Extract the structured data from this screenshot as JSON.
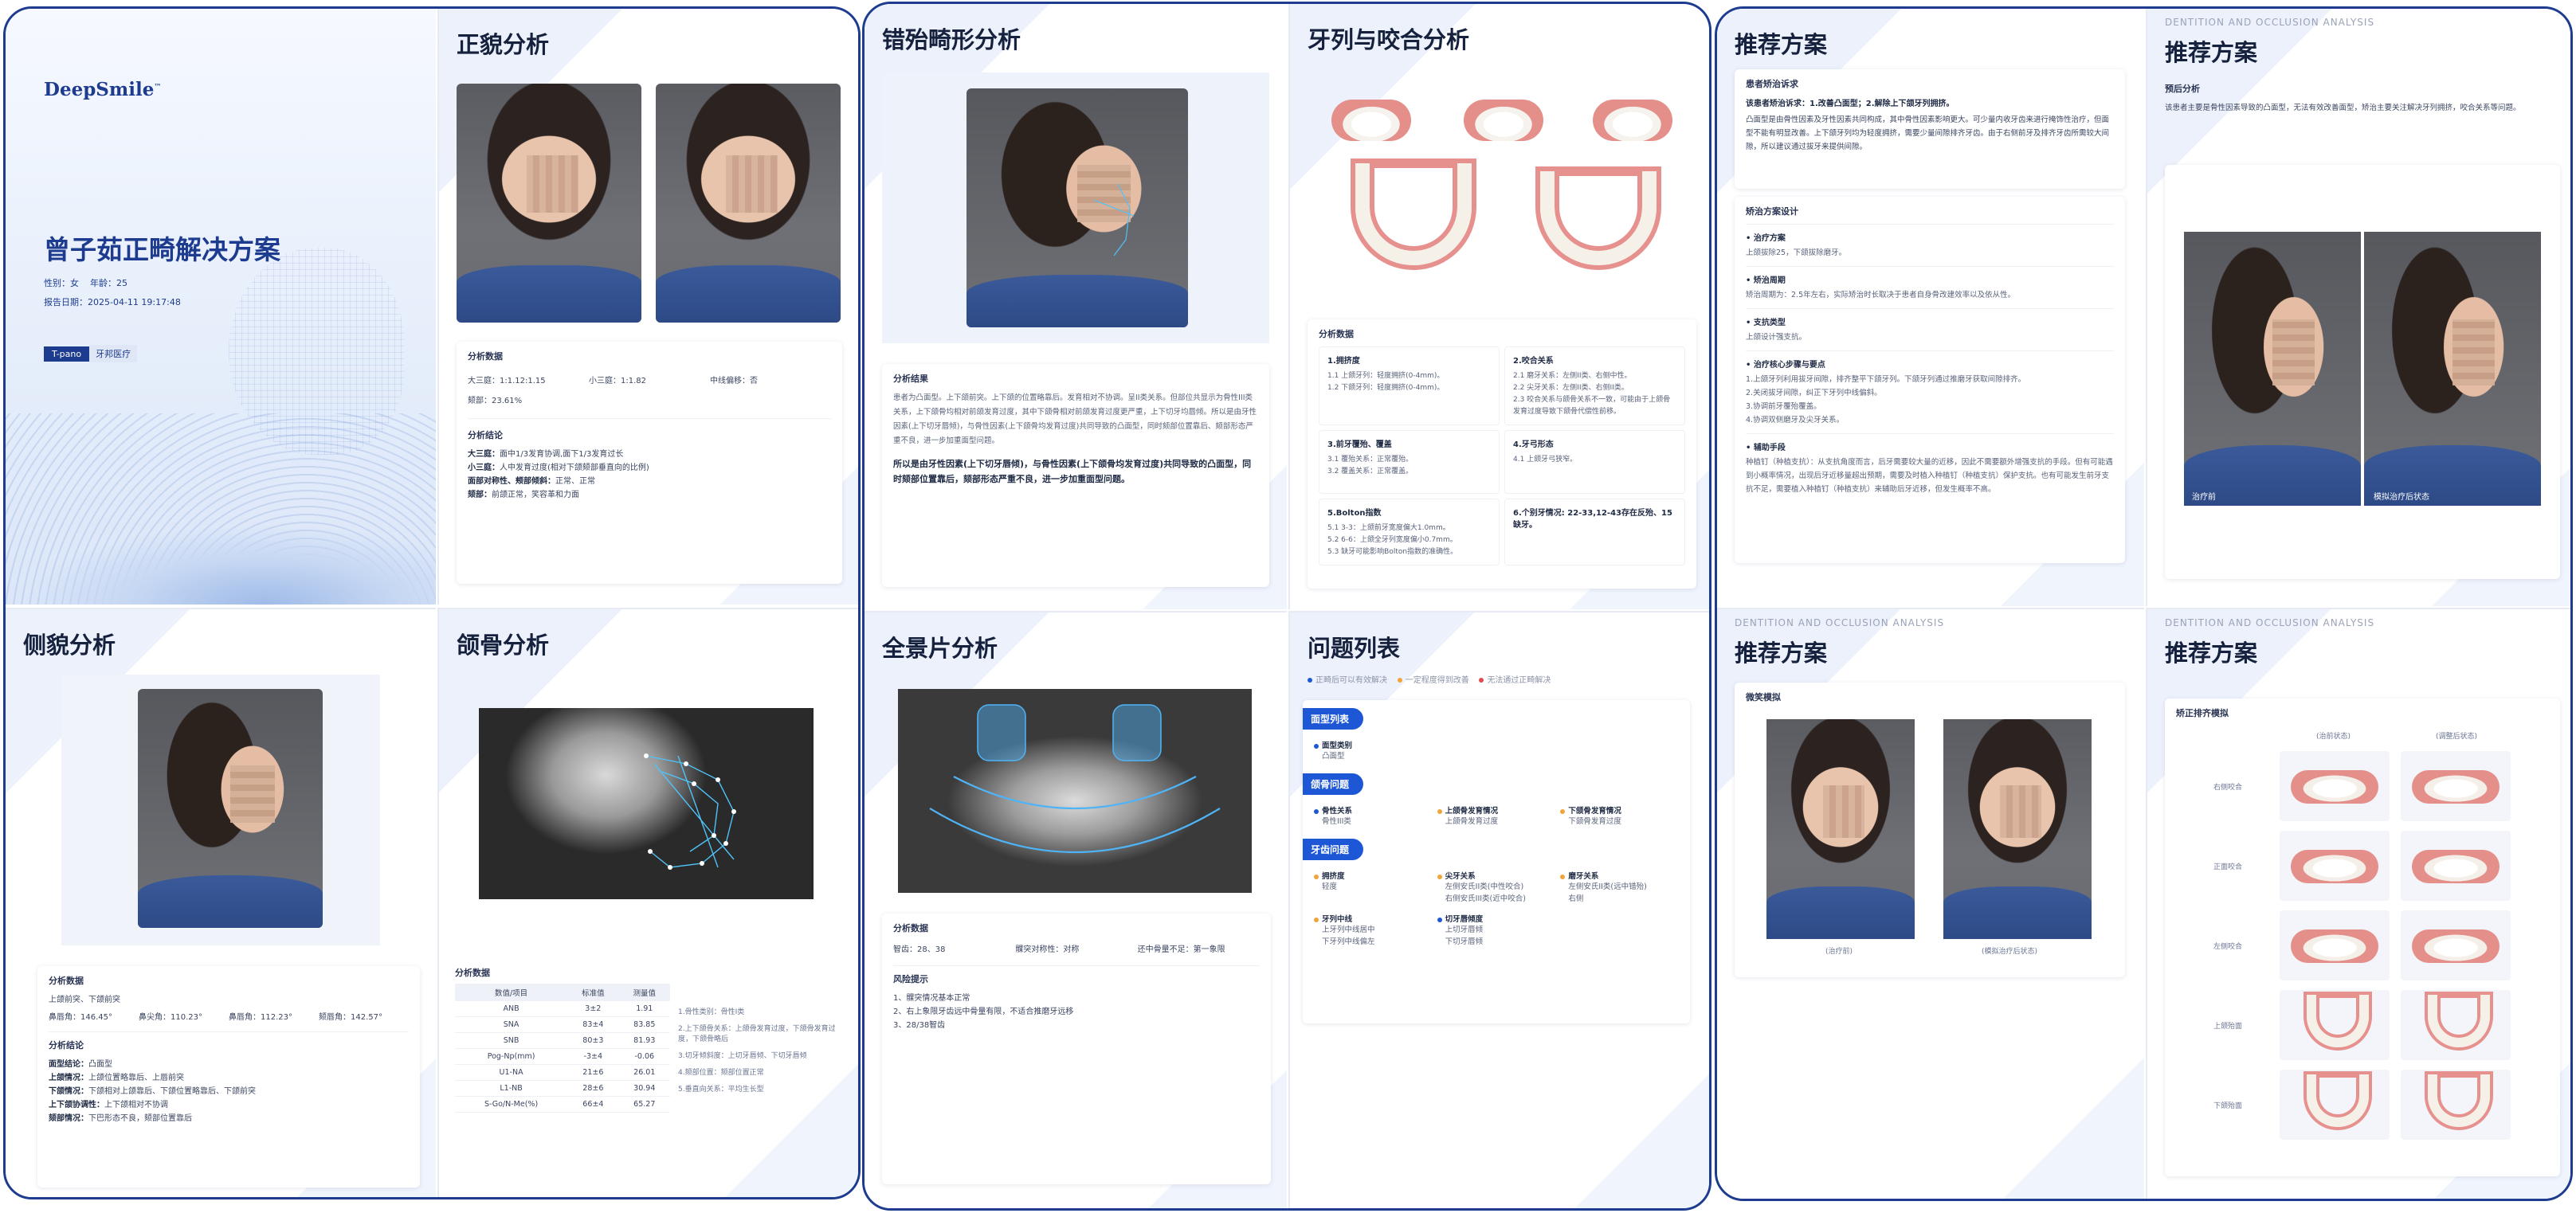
{
  "colors": {
    "brand": "#1d3b8f",
    "accent": "#1d57d6",
    "cover_bg": "#e9f0fb"
  },
  "cover": {
    "logo": "DeepSmile",
    "logo_tm": "™",
    "title": "曾子茹正畸解决方案",
    "gender": "性别：女",
    "age": "年龄：25",
    "report_date": "报告日期：2025-04-11 19:17:48",
    "brand_tag": "T-pano",
    "brand_tag2": "牙邦医疗"
  },
  "frontal": {
    "title": "正貌分析",
    "data_title": "分析数据",
    "items": [
      "大三庭：1:1.12:1.15",
      "小三庭：1:1.82",
      "中线偏移：否",
      "颏部：23.61%"
    ],
    "conclusion_title": "分析结论",
    "conclusions": [
      {
        "k": "大三庭：",
        "v": "面中1/3发育协调,面下1/3发育过长"
      },
      {
        "k": "小三庭：",
        "v": "人中发育过度(相对下颌颏部垂直向的比例)"
      },
      {
        "k": "面部对称性、颊部倾斜：",
        "v": "正常、正常"
      },
      {
        "k": "颏部：",
        "v": "前颌正常，笑容革和力面"
      }
    ]
  },
  "lateral": {
    "title": "侧貌分析",
    "data_title": "分析数据",
    "line1": "上颌前突、下颌前突",
    "angles": [
      "鼻唇角：146.45°",
      "鼻尖角：110.23°",
      "鼻唇角：112.23°",
      "颏唇角：142.57°"
    ],
    "conclusion_title": "分析结论",
    "conclusions": [
      {
        "k": "面型结论：",
        "v": "凸面型"
      },
      {
        "k": "上颌情况：",
        "v": "上颌位置略靠后、上唇前突"
      },
      {
        "k": "下颌情况：",
        "v": "下颌相对上颌靠后、下颌位置略靠后、下颌前突"
      },
      {
        "k": "上下颌协调性：",
        "v": "上下颌相对不协调"
      },
      {
        "k": "颏部情况：",
        "v": "下巴形态不良，颏部位置靠后"
      }
    ]
  },
  "ceph": {
    "title": "颌骨分析",
    "data_title": "分析数据",
    "headers": [
      "数值/项目",
      "标准值",
      "测量值"
    ],
    "rows": [
      [
        "ANB",
        "3±2",
        "1.91"
      ],
      [
        "SNA",
        "83±4",
        "83.85"
      ],
      [
        "SNB",
        "80±3",
        "81.93"
      ],
      [
        "Pog-Np(mm)",
        "-3±4",
        "-0.06"
      ],
      [
        "U1-NA",
        "21±6",
        "26.01"
      ],
      [
        "L1-NB",
        "28±6",
        "30.94"
      ],
      [
        "S-Go/N-Me(%)",
        "66±4",
        "65.27"
      ]
    ],
    "notes": [
      "1.骨性类别：骨性I类",
      "2.上下颌骨关系：上颌骨发育过度，下颌骨发育过度，下颌骨略后",
      "3.切牙倾斜度：上切牙唇倾、下切牙唇倾",
      "4.颏部位置：颏部位置正常",
      "5.垂直向关系：平均生长型"
    ]
  },
  "malocclusion": {
    "title": "错殆畸形分析",
    "result_title": "分析结果",
    "paragraph": "患者为凸面型。上下颌前突。上下颌的位置略靠后。发育相对不协调。呈II类关系。但部位共显示为骨性III类关系，上下颌骨均相对前颌发育过度，其中下颌骨相对前颌发育过度更严重，上下切牙均唇倾。所以是由牙性因素(上下切牙唇倾)，与骨性因素(上下颌骨均发育过度)共同导致的凸面型，同时颏部位置靠后、颏部形态严重不良，进一步加重面型问题。",
    "bold": "所以是由牙性因素(上下切牙唇倾)，与骨性因素(上下颌骨均发育过度)共同导致的凸面型，同时颏部位置靠后，颏部形态严重不良，进一步加重面型问题。"
  },
  "dentition": {
    "title": "牙列与咬合分析",
    "data_title": "分析数据",
    "boxes": [
      {
        "h": "1.拥挤度",
        "lines": [
          "1.1  上颌牙列：轻度拥挤(0-4mm)。",
          "1.2  下颌牙列：轻度拥挤(0-4mm)。"
        ]
      },
      {
        "h": "2.咬合关系",
        "lines": [
          "2.1  磨牙关系：左侧II类、右侧中性。",
          "2.2  尖牙关系：左侧II类、右侧II类。",
          "2.3  咬合关系与颌骨关系不一致，可能由于上颌骨发育过度导致下颌骨代偿性前移。"
        ]
      },
      {
        "h": "3.前牙覆殆、覆盖",
        "lines": [
          "3.1  覆殆关系：正常覆殆。",
          "3.2  覆盖关系：正常覆盖。"
        ]
      },
      {
        "h": "4.牙弓形态",
        "lines": [
          "4.1  上颌牙弓狭窄。"
        ]
      },
      {
        "h": "5.Bolton指数",
        "lines": [
          "5.1  3-3：上颌前牙宽度偏大1.0mm。",
          "5.2  6-6：上颌全牙列宽度偏小0.7mm。",
          "5.3  缺牙可能影响Bolton指数的准确性。"
        ]
      },
      {
        "h": "6.个别牙情况: 22-33,12-43存在反殆、15缺牙。",
        "lines": []
      }
    ]
  },
  "pano": {
    "title": "全景片分析",
    "data_title": "分析数据",
    "items": [
      "智齿：28、38",
      "髁突对称性：对称",
      "还中骨量不足：第一象限"
    ],
    "risk_title": "风险提示",
    "risks": [
      "1、髁突情况基本正常",
      "2、右上象限牙齿远中骨量有限，不适合推磨牙远移",
      "3、28/38智齿"
    ]
  },
  "problems": {
    "title": "问题列表",
    "legend": [
      "正畸后可以有效解决",
      "一定程度得到改善",
      "无法通过正畸解决"
    ],
    "sections": [
      {
        "name": "面型列表",
        "items": [
          {
            "h": "面型类别",
            "v": "凸面型"
          }
        ]
      },
      {
        "name": "颌骨问题",
        "items": [
          {
            "h": "骨性关系",
            "v": "骨性III类"
          },
          {
            "h": "上颌骨发育情况",
            "v": "上颌骨发育过度"
          },
          {
            "h": "下颌骨发育情况",
            "v": "下颌骨发育过度"
          }
        ]
      },
      {
        "name": "牙齿问题",
        "items": [
          {
            "h": "拥挤度",
            "v": "轻度"
          },
          {
            "h": "尖牙关系",
            "v": "左侧安氏II类(中性咬合)\n右侧安氏III类(近中咬合)"
          },
          {
            "h": "磨牙关系",
            "v": "左侧安氏II类(远中错殆)\n右侧"
          },
          {
            "h": "牙列中线",
            "v": "上牙列中线居中\n下牙列中线偏左"
          },
          {
            "h": "切牙唇倾度",
            "v": "上切牙唇倾\n下切牙唇倾"
          }
        ]
      }
    ]
  },
  "plan1": {
    "title": "推荐方案",
    "demand_title": "患者矫治诉求",
    "demand_bold": "该患者矫治诉求：1.改善凸面型；2.解除上下颌牙列拥挤。",
    "demand_text": "凸面型是由骨性因素及牙性因素共同构成，其中骨性因素影响更大。可少量内收牙齿来进行掩饰性治疗，但面型不能有明显改善。上下颌牙列均为轻度拥挤，需要少量间隙排齐牙齿。由于右侧前牙及排齐牙齿所需较大间隙，所以建议通过拔牙来提供间隙。",
    "design_title": "矫治方案设计",
    "sections": [
      {
        "h": "治疗方案",
        "t": "上颌拔除25，下颌拔除磨牙。"
      },
      {
        "h": "矫治周期",
        "t": "矫治周期为：2.5年左右，实际矫治时长取决于患者自身骨改建效率以及依从性。"
      },
      {
        "h": "支抗类型",
        "t": "上颌设计强支抗。"
      },
      {
        "h": "治疗核心步骤与要点",
        "t": "1.上颌牙列利用拔牙间隙，排齐整平下颌牙列。下颌牙列通过推磨牙获取间隙排齐。\n2.关闭拔牙间隙，纠正下牙列中线偏斜。\n3.协调前牙覆殆覆盖。\n4.协调双侧磨牙及尖牙关系。"
      },
      {
        "h": "辅助手段",
        "t": "种植钉（种植支抗）：从支抗角度而言，后牙需要较大量的近移，因此不需要额外增强支抗的手段。但有可能遇到小概率情况，出现后牙近移量超出预期，需要及时植入种植钉（种植支抗）保护支抗。也有可能发生前牙支抗不足，需要植入种植钉（种植支抗）来辅助后牙近移，但发生概率不高。"
      }
    ]
  },
  "plan2": {
    "subhead": "DENTITION AND OCCLUSION ANALYSIS",
    "title": "推荐方案",
    "prog_title": "预后分析",
    "prog_text": "该患者主要是骨性因素导致的凸面型，无法有效改善面型，矫治主要关注解决牙列拥挤，咬合关系等问题。",
    "label_left": "治疗前",
    "label_right": "模拟治疗后状态"
  },
  "plan3": {
    "subhead": "DENTITION AND OCCLUSION ANALYSIS",
    "title": "推荐方案",
    "card_title": "微笑模拟",
    "cap_left": "(治疗前)",
    "cap_right": "(模拟治疗后状态)"
  },
  "plan4": {
    "subhead": "DENTITION AND OCCLUSION ANALYSIS",
    "title": "推荐方案",
    "card_title": "矫正排齐模拟",
    "col_left": "(治前状态)",
    "col_right": "(调整后状态)",
    "rows": [
      "右侧咬合",
      "正面咬合",
      "左侧咬合",
      "上颌殆面",
      "下颌殆面"
    ]
  }
}
